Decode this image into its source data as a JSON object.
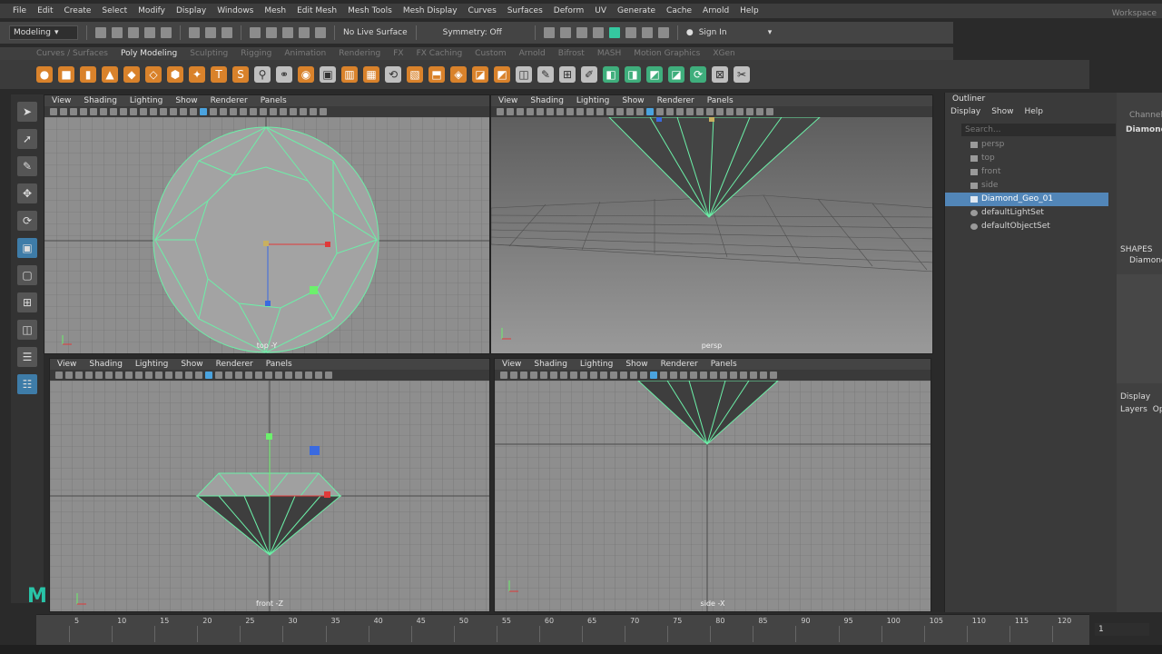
{
  "menubar": {
    "items": [
      "File",
      "Edit",
      "Create",
      "Select",
      "Modify",
      "Display",
      "Windows",
      "Mesh",
      "Edit Mesh",
      "Mesh Tools",
      "Mesh Display",
      "Curves",
      "Surfaces",
      "Deform",
      "UV",
      "Generate",
      "Cache",
      "Arnold",
      "Help"
    ],
    "workspace": "Workspace"
  },
  "statusline": {
    "mode": "Modeling",
    "live_surface": "No Live Surface",
    "symmetry": "Symmetry: Off",
    "sign_in": "Sign In"
  },
  "shelf": {
    "tabs": [
      "Curves / Surfaces",
      "Poly Modeling",
      "Sculpting",
      "Rigging",
      "Animation",
      "Rendering",
      "FX",
      "FX Caching",
      "Custom",
      "Arnold",
      "Bifrost",
      "MASH",
      "Motion Graphics",
      "XGen"
    ],
    "active_tab": "Poly Modeling"
  },
  "viewport_menu": [
    "View",
    "Shading",
    "Lighting",
    "Show",
    "Renderer",
    "Panels"
  ],
  "viewports": {
    "top": "top -Y",
    "persp": "persp",
    "front": "front -Z",
    "side": "side -X"
  },
  "outliner": {
    "title": "Outliner",
    "menu": [
      "Display",
      "Show",
      "Help"
    ],
    "search_placeholder": "Search...",
    "items": [
      "persp",
      "top",
      "front",
      "side",
      "Diamond_Geo_01",
      "defaultLightSet",
      "defaultObjectSet"
    ],
    "selected": "Diamond_Geo_01"
  },
  "channel_box": {
    "title": "Channels",
    "object": "Diamond",
    "shapes_label": "SHAPES",
    "shape_name": "Diamond",
    "display_tab": "Display",
    "layers_tabs": [
      "Layers",
      "Opt"
    ]
  },
  "timeline": {
    "ticks": [
      "5",
      "10",
      "15",
      "20",
      "25",
      "30",
      "35",
      "40",
      "45",
      "50",
      "55",
      "60",
      "65",
      "70",
      "75",
      "80",
      "85",
      "90",
      "95",
      "100",
      "105",
      "110",
      "115",
      "120"
    ],
    "current_frame": "1"
  },
  "colors": {
    "wire": "#6cf0a8",
    "selection": "#5286b8",
    "viewport_bg": "#8e8e8e"
  }
}
